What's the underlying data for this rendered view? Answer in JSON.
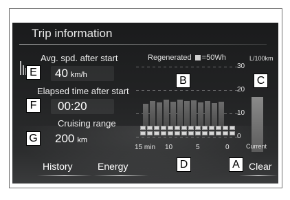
{
  "screen": {
    "title": "Trip information",
    "avg_speed": {
      "label": "Avg. spd. after start",
      "value": "40",
      "unit": "km/h"
    },
    "elapsed": {
      "label": "Elapsed time after start",
      "value": "00:20"
    },
    "range": {
      "label": "Cruising range",
      "value": "200",
      "unit": "km"
    },
    "regenerated_prefix": "Regenerated",
    "regenerated_suffix": "=50Wh",
    "units_label": "L/100km",
    "y_axis_ticks": [
      "30",
      "20",
      "10",
      "0"
    ],
    "x_axis_ticks": [
      "15 min",
      "10",
      "5",
      "0"
    ],
    "current_label": "Current",
    "buttons": {
      "history": "History",
      "energy": "Energy",
      "clear": "Clear"
    }
  },
  "callouts": {
    "A": "A",
    "B": "B",
    "C": "C",
    "D": "D",
    "E": "E",
    "F": "F",
    "G": "G"
  },
  "colors": {
    "screen_bg": "#222324",
    "text": "#ffffff",
    "bar": "#5a5a5a",
    "regen_box": "#d8d8d8"
  }
}
